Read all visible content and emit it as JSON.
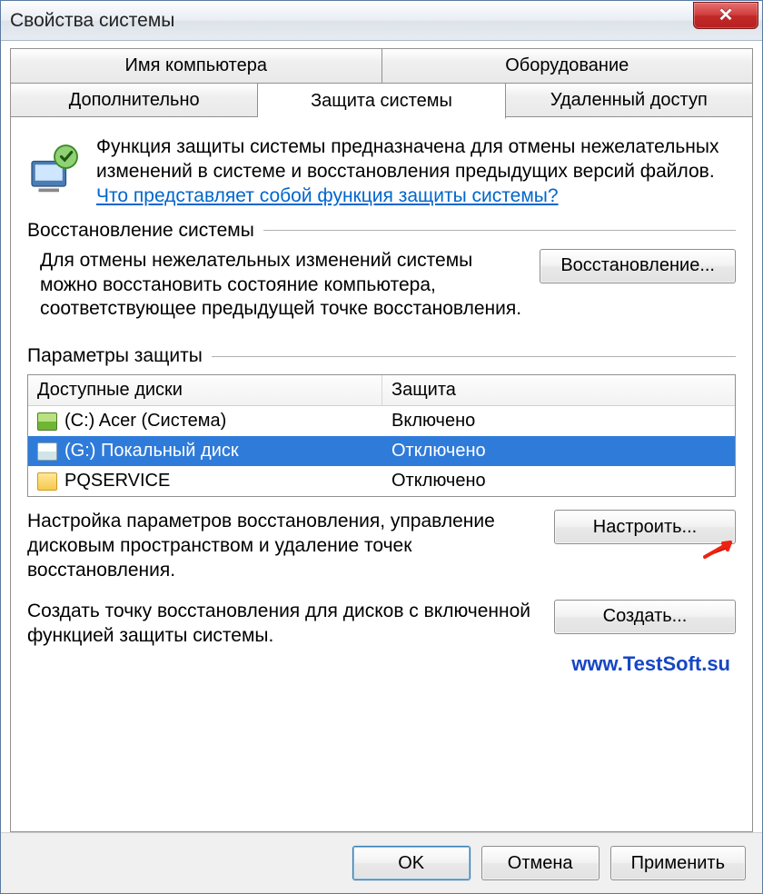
{
  "titlebar": {
    "title": "Свойства системы"
  },
  "tabs": {
    "row1": [
      {
        "label": "Имя компьютера"
      },
      {
        "label": "Оборудование"
      }
    ],
    "row2": [
      {
        "label": "Дополнительно"
      },
      {
        "label": "Защита системы"
      },
      {
        "label": "Удаленный доступ"
      }
    ]
  },
  "intro": {
    "text": "Функция защиты системы предназначена для отмены нежелательных изменений в системе и восстановления предыдущих версий файлов. ",
    "link": "Что представляет собой функция защиты системы?"
  },
  "groups": {
    "restore_label": "Восстановление системы",
    "restore_text": "Для отмены нежелательных изменений системы можно восстановить состояние компьютера, соответствующее предыдущей точке восстановления.",
    "restore_btn": "Восстановление...",
    "protect_label": "Параметры защиты",
    "configure_text": "Настройка параметров восстановления, управление дисковым пространством и удаление точек восстановления.",
    "configure_btn": "Настроить...",
    "create_text": "Создать точку восстановления для дисков с включенной функцией защиты системы.",
    "create_btn": "Создать..."
  },
  "list": {
    "col_a": "Доступные диски",
    "col_b": "Защита",
    "rows": [
      {
        "name": "(C:) Acer (Система)",
        "status": "Включено",
        "icon": "disk-c",
        "selected": false
      },
      {
        "name": "(G:) Покальный диск",
        "status": "Отключено",
        "icon": "disk-g",
        "selected": true
      },
      {
        "name": "PQSERVICE",
        "status": "Отключено",
        "icon": "disk-folder",
        "selected": false
      }
    ]
  },
  "watermark": "www.TestSoft.su",
  "buttons": {
    "ok": "OK",
    "cancel": "Отмена",
    "apply": "Применить"
  }
}
